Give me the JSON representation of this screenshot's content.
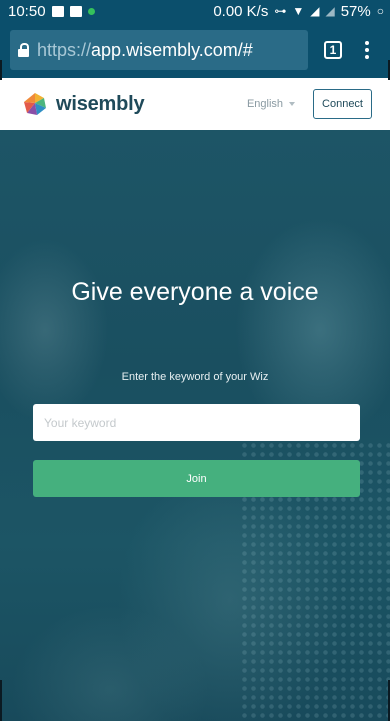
{
  "status_bar": {
    "time": "10:50",
    "network_speed": "0.00 K/s",
    "battery": "57%"
  },
  "browser": {
    "url_scheme": "https://",
    "url_host": "app.wisembly.com/#",
    "tab_count": "1"
  },
  "header": {
    "logo_text": "wisembly",
    "language": "English",
    "connect_label": "Connect"
  },
  "hero": {
    "title": "Give everyone a voice",
    "subtitle": "Enter the keyword of your Wiz",
    "keyword_placeholder": "Your keyword",
    "join_label": "Join"
  },
  "colors": {
    "brand_teal": "#0b4f6c",
    "join_green": "#45b07e"
  }
}
